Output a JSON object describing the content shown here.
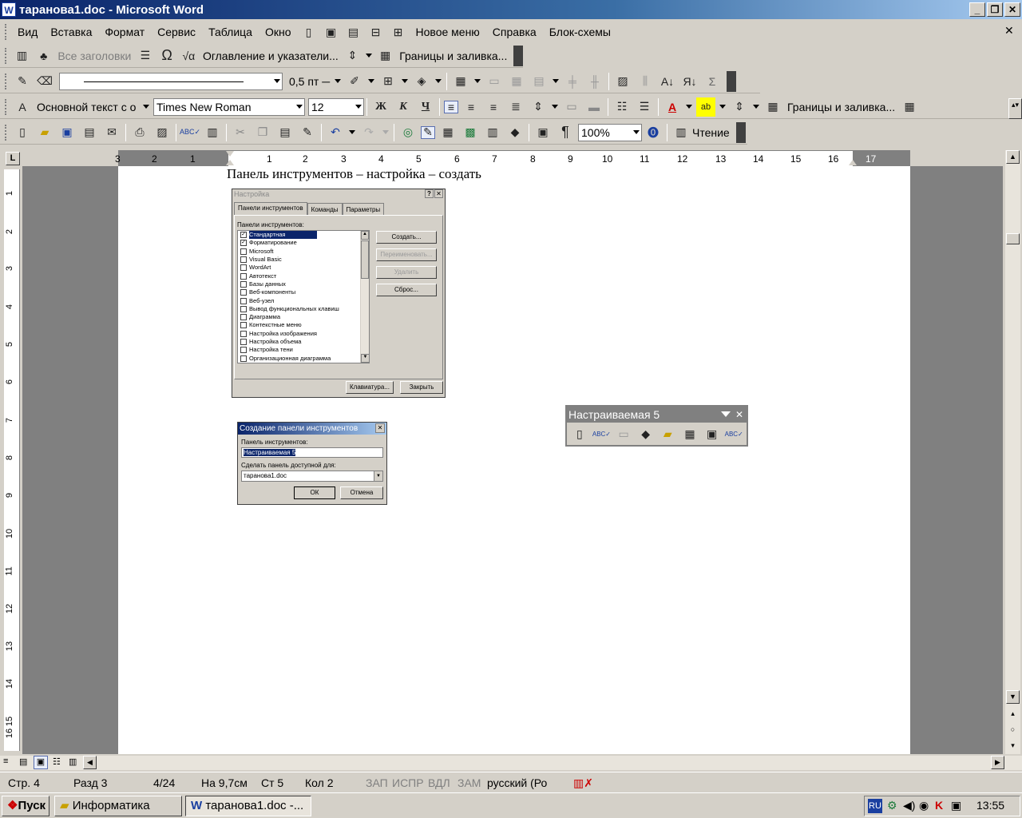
{
  "window": {
    "title": "таранова1.doc - Microsoft Word",
    "app_icon": "W",
    "min_label": "_",
    "restore_label": "❐",
    "close_label": "✕"
  },
  "menubar": {
    "items": [
      "Вид",
      "Вставка",
      "Формат",
      "Сервис",
      "Таблица",
      "Окно",
      "Новое меню",
      "Справка",
      "Блок-схемы"
    ],
    "close_label": "✕"
  },
  "toolbar1": {
    "all_headings": "Все заголовки",
    "omega": "Ω",
    "toc": "Оглавление и указатели...",
    "borders": "Границы и заливка..."
  },
  "toolbar2": {
    "line_width": "0,5 пт"
  },
  "format_toolbar": {
    "style": "Основной текст с о",
    "font": "Times New Roman",
    "size": "12",
    "bold": "Ж",
    "italic": "К",
    "underline": "Ч",
    "borders": "Границы и заливка..."
  },
  "standard_toolbar": {
    "zoom": "100%",
    "reading": "Чтение",
    "pilcrow": "¶"
  },
  "ruler": {
    "ticks": [
      "3",
      "2",
      "1",
      "1",
      "2",
      "3",
      "4",
      "5",
      "6",
      "7",
      "8",
      "9",
      "10",
      "11",
      "12",
      "13",
      "14",
      "15",
      "16",
      "17"
    ],
    "tab_selector": "L"
  },
  "vruler": {
    "ticks": [
      "1",
      "2",
      "3",
      "4",
      "5",
      "6",
      "7",
      "8",
      "9",
      "10",
      "11",
      "12",
      "13",
      "14",
      "15",
      "16"
    ]
  },
  "document": {
    "heading": "Панель инструментов – настройка – создать"
  },
  "customize_dialog": {
    "title": "Настройка",
    "help": "?",
    "close": "✕",
    "tabs": [
      "Панели инструментов",
      "Команды",
      "Параметры"
    ],
    "list_label": "Панели инструментов:",
    "items": [
      {
        "label": "Стандартная",
        "checked": true
      },
      {
        "label": "Форматирование",
        "checked": true
      },
      {
        "label": "Microsoft",
        "checked": false
      },
      {
        "label": "Visual Basic",
        "checked": false
      },
      {
        "label": "WordArt",
        "checked": false
      },
      {
        "label": "Автотекст",
        "checked": false
      },
      {
        "label": "Базы данных",
        "checked": false
      },
      {
        "label": "Веб-компоненты",
        "checked": false
      },
      {
        "label": "Веб-узел",
        "checked": false
      },
      {
        "label": "Вывод функциональных клавиш",
        "checked": false
      },
      {
        "label": "Диаграмма",
        "checked": false
      },
      {
        "label": "Контекстные меню",
        "checked": false
      },
      {
        "label": "Настройка изображения",
        "checked": false
      },
      {
        "label": "Настройка объема",
        "checked": false
      },
      {
        "label": "Настройка тени",
        "checked": false
      },
      {
        "label": "Организационная диаграмма",
        "checked": false
      }
    ],
    "buttons": {
      "create": "Создать...",
      "rename": "Переименовать...",
      "delete": "Удалить",
      "reset": "Сброс...",
      "keyboard": "Клавиатура...",
      "close": "Закрыть"
    }
  },
  "new_toolbar_dialog": {
    "title": "Создание панели инструментов",
    "close": "✕",
    "name_label": "Панель инструментов:",
    "name_value": "Настраиваемая 5",
    "available_label": "Сделать панель доступной для:",
    "available_value": "таранова1.doc",
    "ok": "ОК",
    "cancel": "Отмена"
  },
  "floating_toolbar": {
    "title": "Настраиваемая 5",
    "close": "✕"
  },
  "statusbar": {
    "page": "Стр. 4",
    "section": "Разд 3",
    "pages": "4/24",
    "at": "На 9,7см",
    "line": "Ст 5",
    "col": "Кол 2",
    "rec": "ЗАП",
    "trk": "ИСПР",
    "ext": "ВДЛ",
    "ovr": "ЗАМ",
    "lang": "русский (Ро"
  },
  "taskbar": {
    "start": "Пуск",
    "task1": "Информатика",
    "task2": "таранова1.doc -...",
    "lang": "RU",
    "clock": "13:55"
  }
}
